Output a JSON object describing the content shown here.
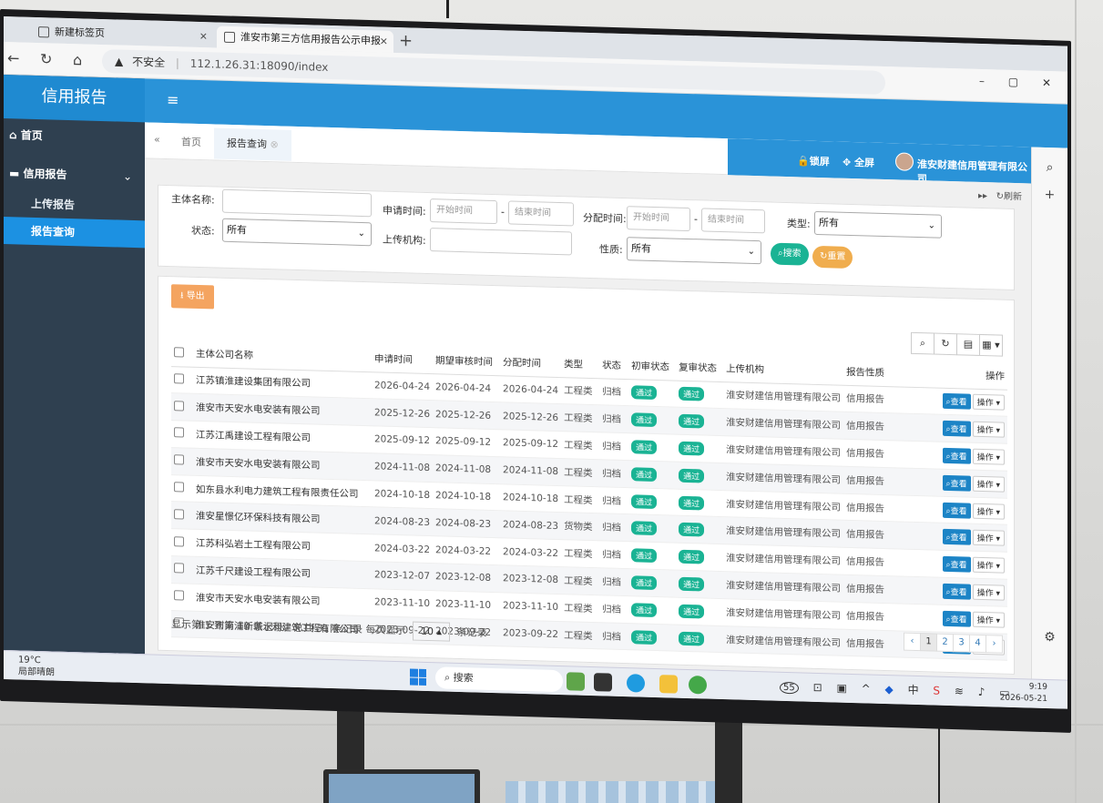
{
  "browser": {
    "tabs": [
      {
        "title": "新建标签页",
        "close": "×"
      },
      {
        "title": "淮安市第三方信用报告公示申报系",
        "close": "×"
      }
    ],
    "new_tab": "+",
    "security": "不安全",
    "url": "112.1.26.31:18090/index"
  },
  "app": {
    "brand": "信用报告",
    "menu": {
      "home": "首页",
      "credit_report": "信用报告",
      "subitems": [
        "上传报告",
        "报告查询"
      ]
    },
    "page_tabs": {
      "home": "首页",
      "active": "报告查询"
    },
    "header": {
      "lock": "锁屏",
      "fullscreen": "全屏",
      "org": "淮安财建信用管理有限公司"
    },
    "refresh": "刷新"
  },
  "filter": {
    "subject_label": "主体名称:",
    "apply_time_label": "申请时间:",
    "assign_time_label": "分配时间:",
    "status_label": "状态:",
    "upload_org_label": "上传机构:",
    "nature_label": "性质:",
    "type_label": "类型:",
    "start_placeholder": "开始时间",
    "end_placeholder": "结束时间",
    "status_value": "所有",
    "nature_value": "所有",
    "type_value": "所有",
    "search_label": "搜索",
    "reset_label": "重置"
  },
  "table": {
    "export_label": "导出",
    "columns": [
      "主体公司名称",
      "申请时间",
      "期望审核时间",
      "分配时间",
      "类型",
      "状态",
      "初审状态",
      "复审状态",
      "上传机构",
      "报告性质",
      "操作"
    ],
    "view_label": "查看",
    "op_label": "操作",
    "rows": [
      {
        "company": "江苏镇淮建设集团有限公司",
        "apply": "2026-04-24",
        "expected": "2026-04-24",
        "assign": "2026-04-24",
        "type": "工程类",
        "status": "归档",
        "first": "通过",
        "second": "通过",
        "org": "淮安财建信用管理有限公司",
        "nature": "信用报告"
      },
      {
        "company": "淮安市天安水电安装有限公司",
        "apply": "2025-12-26",
        "expected": "2025-12-26",
        "assign": "2025-12-26",
        "type": "工程类",
        "status": "归档",
        "first": "通过",
        "second": "通过",
        "org": "淮安财建信用管理有限公司",
        "nature": "信用报告"
      },
      {
        "company": "江苏江禹建设工程有限公司",
        "apply": "2025-09-12",
        "expected": "2025-09-12",
        "assign": "2025-09-12",
        "type": "工程类",
        "status": "归档",
        "first": "通过",
        "second": "通过",
        "org": "淮安财建信用管理有限公司",
        "nature": "信用报告"
      },
      {
        "company": "淮安市天安水电安装有限公司",
        "apply": "2024-11-08",
        "expected": "2024-11-08",
        "assign": "2024-11-08",
        "type": "工程类",
        "status": "归档",
        "first": "通过",
        "second": "通过",
        "org": "淮安财建信用管理有限公司",
        "nature": "信用报告"
      },
      {
        "company": "如东县水利电力建筑工程有限责任公司",
        "apply": "2024-10-18",
        "expected": "2024-10-18",
        "assign": "2024-10-18",
        "type": "工程类",
        "status": "归档",
        "first": "通过",
        "second": "通过",
        "org": "淮安财建信用管理有限公司",
        "nature": "信用报告"
      },
      {
        "company": "淮安星憬亿环保科技有限公司",
        "apply": "2024-08-23",
        "expected": "2024-08-23",
        "assign": "2024-08-23",
        "type": "货物类",
        "status": "归档",
        "first": "通过",
        "second": "通过",
        "org": "淮安财建信用管理有限公司",
        "nature": "信用报告"
      },
      {
        "company": "江苏科弘岩土工程有限公司",
        "apply": "2024-03-22",
        "expected": "2024-03-22",
        "assign": "2024-03-22",
        "type": "工程类",
        "status": "归档",
        "first": "通过",
        "second": "通过",
        "org": "淮安财建信用管理有限公司",
        "nature": "信用报告"
      },
      {
        "company": "江苏千尺建设工程有限公司",
        "apply": "2023-12-07",
        "expected": "2023-12-08",
        "assign": "2023-12-08",
        "type": "工程类",
        "status": "归档",
        "first": "通过",
        "second": "通过",
        "org": "淮安财建信用管理有限公司",
        "nature": "信用报告"
      },
      {
        "company": "淮安市天安水电安装有限公司",
        "apply": "2023-11-10",
        "expected": "2023-11-10",
        "assign": "2023-11-10",
        "type": "工程类",
        "status": "归档",
        "first": "通过",
        "second": "通过",
        "org": "淮安财建信用管理有限公司",
        "nature": "信用报告"
      },
      {
        "company": "淮安市南浦新城水利建筑工程有限公司",
        "apply": "2023-09-22",
        "expected": "2023-09-22",
        "assign": "2023-09-22",
        "type": "工程类",
        "status": "归档",
        "first": "通过",
        "second": "通过",
        "org": "淮安财建信用管理有限公司",
        "nature": "信用报告"
      }
    ],
    "footer_prefix": "显示第 1 到第 10 条记录，总共 31 条记录  每页显示",
    "page_size": "10",
    "footer_suffix": "条记录",
    "pages": [
      "‹",
      "1",
      "2",
      "3",
      "4",
      "›"
    ]
  },
  "taskbar": {
    "temp": "19°C",
    "weather": "局部晴朗",
    "search": "搜索",
    "badge": "55",
    "time": "9:19",
    "date": "2026-05-21"
  }
}
